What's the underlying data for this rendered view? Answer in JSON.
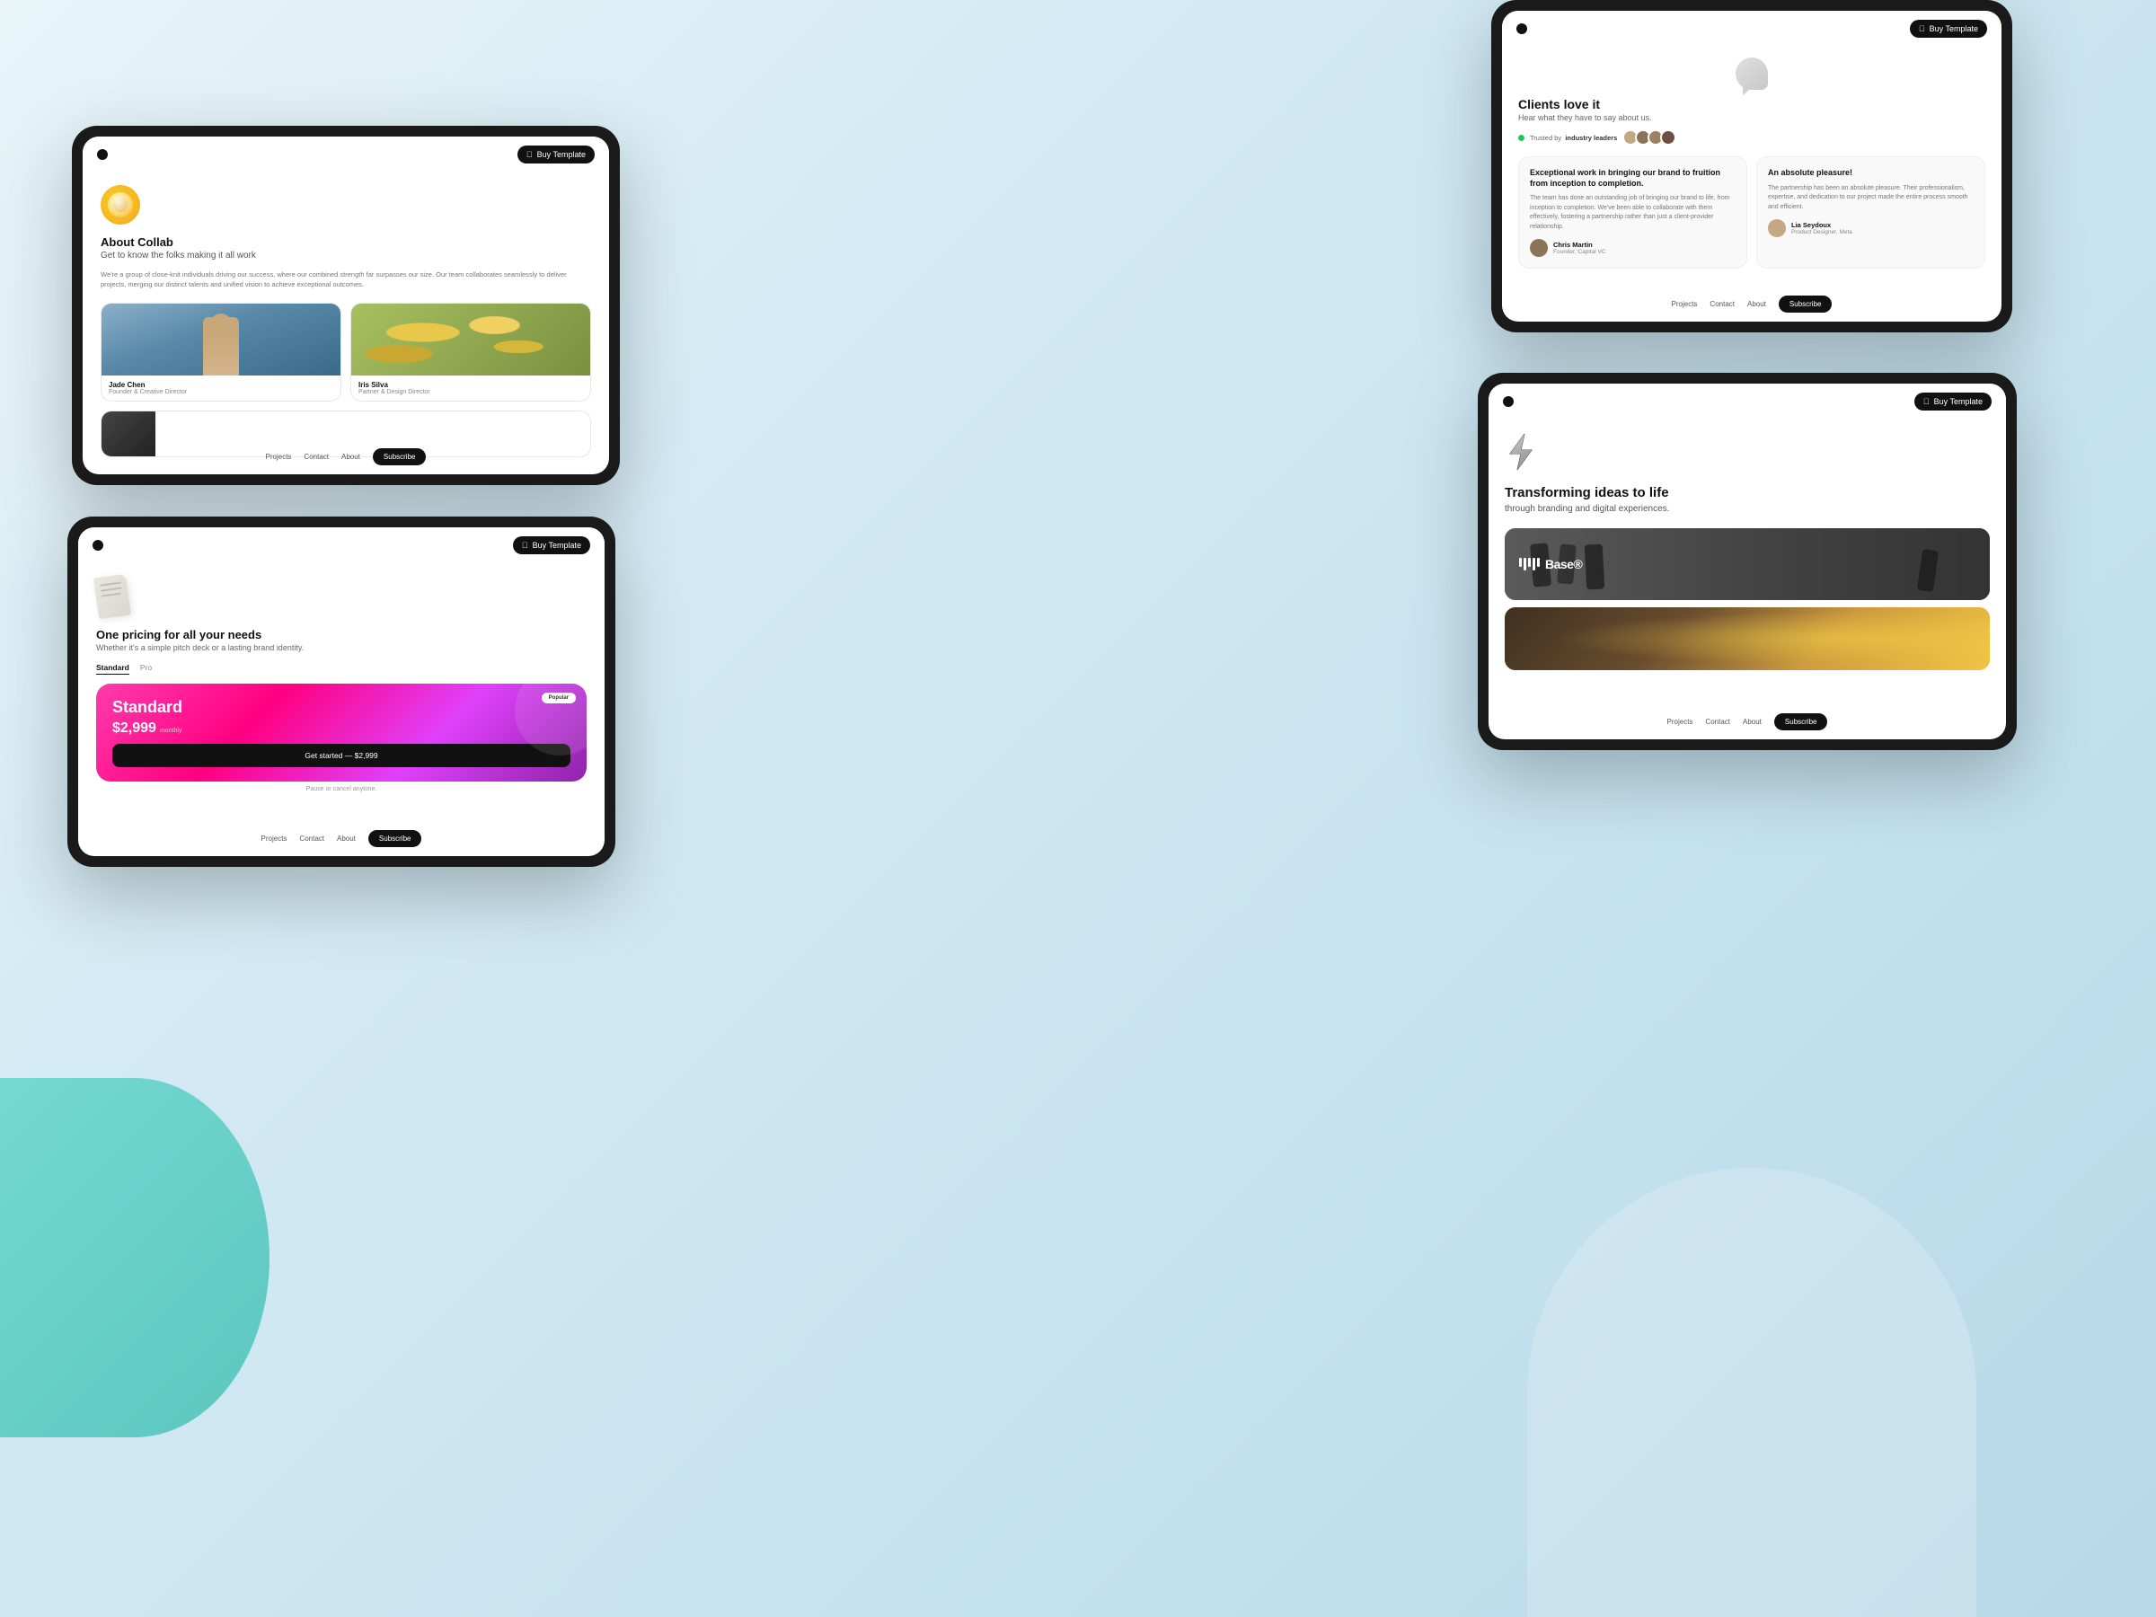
{
  "background": {
    "gradient_from": "#e8f4f8",
    "gradient_to": "#b8d8e8"
  },
  "tablet1": {
    "nav": {
      "logo_alt": "collab-logo",
      "buy_button": "Buy Template"
    },
    "about": {
      "logo_emoji": "🍩",
      "title": "About Collab",
      "subtitle": "Get to know the folks making it all work",
      "description": "We're a group of close-knit individuals driving our success, where our combined strength far surpasses our size. Our team collaborates seamlessly to deliver projects, merging our distinct talents and unified vision to achieve exceptional outcomes.",
      "team": [
        {
          "name": "Jade Chen",
          "role": "Founder & Creative Director",
          "img_alt": "jade-chen-photo"
        },
        {
          "name": "Iris Silva",
          "role": "Partner & Design Director",
          "img_alt": "iris-silva-photo"
        }
      ],
      "third_member": {
        "img_alt": "third-member-photo"
      }
    },
    "bottom_nav": {
      "links": [
        "Projects",
        "Contact",
        "About"
      ],
      "subscribe": "Subscribe"
    }
  },
  "tablet2": {
    "nav": {
      "buy_button": "Buy Template"
    },
    "clients": {
      "title": "Clients love it",
      "subtitle": "Hear what they have to say about us.",
      "trusted_text": "Trusted by",
      "trusted_bold": "industry leaders",
      "testimonials": [
        {
          "title": "Exceptional work in bringing our brand to fruition from inception to completion.",
          "body": "The team has done an outstanding job of bringing our brand to life, from inception to completion. We've been able to collaborate with them effectively, fostering a partnership rather than just a client-provider relationship.",
          "author_name": "Chris Martin",
          "author_role": "Founder, Capital VC",
          "avatar_color": "#8B7355"
        },
        {
          "title": "An absolute pleasure!",
          "body": "The partnership has been an absolute pleasure. Their professionalism, expertise, and dedication to our project made the entire process smooth and efficient.",
          "author_name": "Lia Seydoux",
          "author_role": "Product Designer, Meta",
          "avatar_color": "#C4A882"
        }
      ]
    },
    "bottom_nav": {
      "links": [
        "Projects",
        "Contact",
        "About"
      ],
      "subscribe": "Subscribe"
    }
  },
  "tablet3": {
    "nav": {
      "buy_button": "Buy Template"
    },
    "pricing": {
      "icon_alt": "pricing-icon",
      "title": "One pricing for all your needs",
      "subtitle": "Whether it's a simple pitch deck or a lasting brand identity.",
      "tabs": [
        "Standard",
        "Pro"
      ],
      "active_tab": "Standard",
      "card": {
        "popular_label": "Popular",
        "plan_name": "Standard",
        "amount": "$2,999",
        "period": "monthly",
        "cta": "Get started — $2,999",
        "cancel_text": "Pause or cancel anytime."
      }
    },
    "bottom_nav": {
      "links": [
        "Projects",
        "Contact",
        "About"
      ],
      "subscribe": "Subscribe"
    }
  },
  "tablet4": {
    "nav": {
      "buy_button": "Buy Template"
    },
    "transform": {
      "icon_alt": "lightning-icon",
      "title": "Transforming ideas to life",
      "subtitle": "through branding and digital experiences.",
      "projects": [
        {
          "name": "Base®",
          "type": "dark-athletic"
        },
        {
          "name": "",
          "type": "warm-gradient"
        }
      ]
    },
    "bottom_nav": {
      "links": [
        "Projects",
        "Contact",
        "About"
      ],
      "subscribe": "Subscribe"
    }
  }
}
